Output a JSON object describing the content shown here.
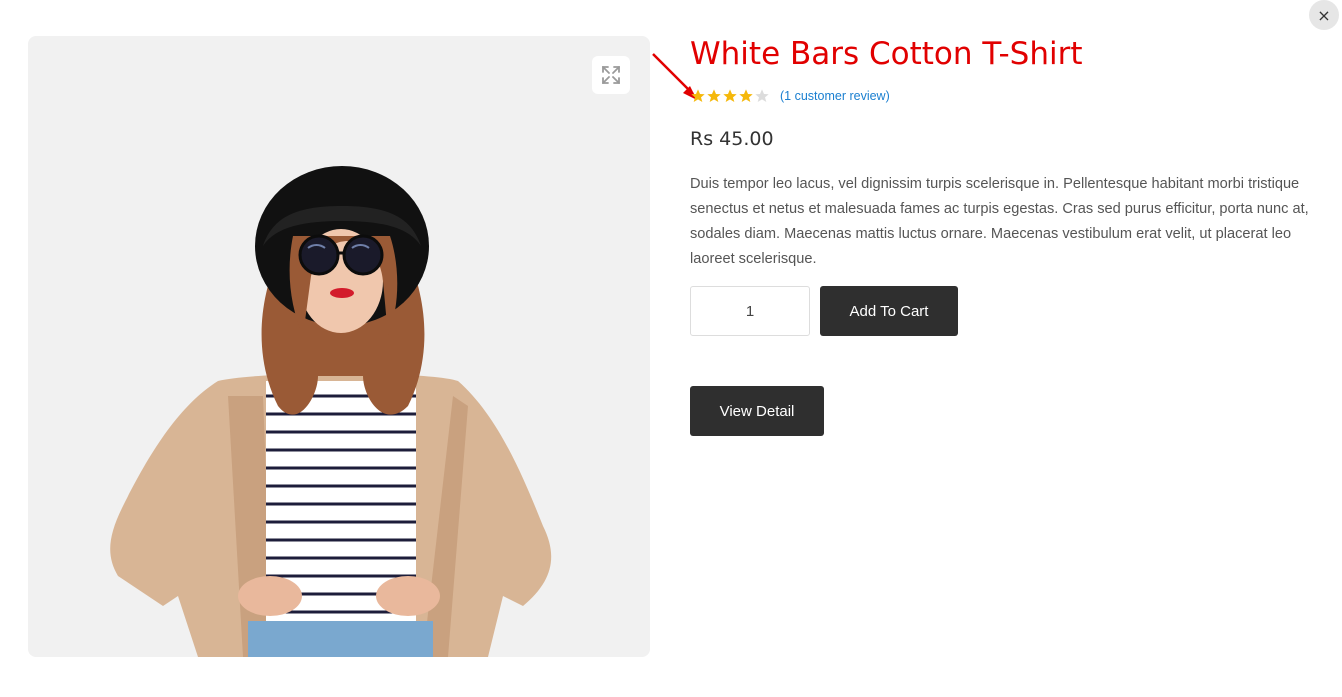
{
  "modal": {
    "close_label": "×"
  },
  "product": {
    "title": "White Bars Cotton T-Shirt",
    "rating": 4,
    "rating_max": 5,
    "review_link": "(1 customer review)",
    "price": "Rs 45.00",
    "description": "Duis tempor leo lacus, vel dignissim turpis scelerisque in. Pellentesque habitant morbi tristique senectus et netus et malesuada fames ac turpis egestas. Cras sed purus efficitur, porta nunc at, sodales diam. Maecenas mattis luctus ornare. Maecenas vestibulum erat velit, ut placerat leo laoreet scelerisque.",
    "quantity": "1",
    "add_to_cart_label": "Add To Cart",
    "view_detail_label": "View Detail"
  },
  "icons": {
    "expand": "expand-icon",
    "close": "close-icon",
    "star": "star-icon"
  },
  "colors": {
    "title": "#e10000",
    "star_filled": "#f5b80b",
    "star_empty": "#dcdcdc",
    "link": "#1a7fd0",
    "button_bg": "#2f2f2f",
    "annotation_arrow": "#e10000"
  }
}
